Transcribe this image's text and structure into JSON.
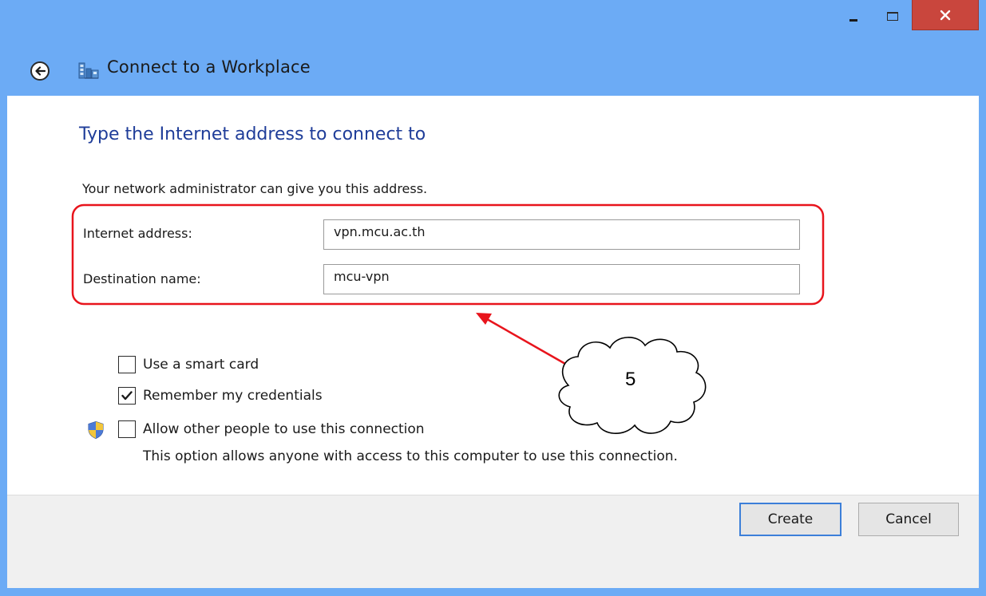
{
  "window": {
    "title": "Connect to a Workplace",
    "icons": {
      "back": "back-arrow-icon",
      "app": "workplace-network-icon",
      "minimize": "minimize-icon",
      "maximize": "maximize-icon",
      "close": "close-icon"
    }
  },
  "content": {
    "heading": "Type the Internet address to connect to",
    "description": "Your network administrator can give you this address.",
    "fields": {
      "internet_address": {
        "label": "Internet address:",
        "value": "vpn.mcu.ac.th"
      },
      "destination_name": {
        "label": "Destination name:",
        "value": "mcu-vpn"
      }
    },
    "options": {
      "smart_card": {
        "label": "Use a smart card",
        "checked": false
      },
      "remember": {
        "label": "Remember my credentials",
        "checked": true
      },
      "allow_others": {
        "label": "Allow other people to use this connection",
        "checked": false,
        "icon": "uac-shield-icon"
      }
    },
    "allow_note": "This option allows anyone with access to this computer to use this connection."
  },
  "footer": {
    "create_label": "Create",
    "cancel_label": "Cancel"
  },
  "annotation": {
    "step_number": "5",
    "highlight_color": "#e8141c"
  },
  "colors": {
    "window_frame": "#6cabf5",
    "heading": "#1f3d99",
    "close_button": "#c9463d",
    "default_button_border": "#3c7fd9"
  }
}
